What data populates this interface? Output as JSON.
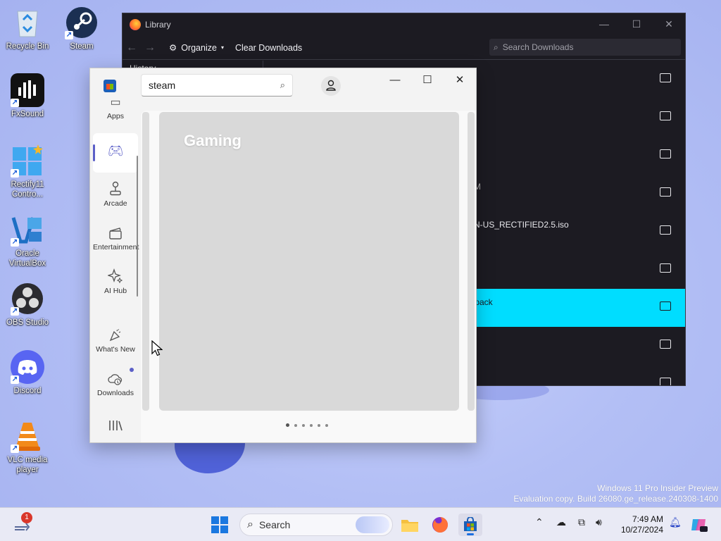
{
  "desktop": {
    "icons": [
      {
        "label": "Recycle Bin"
      },
      {
        "label": "Steam"
      },
      {
        "label": "FxSound"
      },
      {
        "label": "Rectify11 Contro..."
      },
      {
        "label": "Oracle VirtualBox"
      },
      {
        "label": "OBS Studio"
      },
      {
        "label": "Discord"
      },
      {
        "label": "VLC media player"
      }
    ],
    "watermark": {
      "line1": "Windows 11 Pro Insider Preview",
      "line2": "Evaluation copy. Build 26080.ge_release.240308-1400"
    }
  },
  "library": {
    "title": "Library",
    "toolbar": {
      "back": "←",
      "forward": "→",
      "organize": "Organize",
      "clear_downloads": "Clear Downloads"
    },
    "search_placeholder": "Search Downloads",
    "sidebar_history": "History",
    "rows": [
      {
        "name": "",
        "meta": ""
      },
      {
        "name": "",
        "meta": ""
      },
      {
        "name": "",
        "meta": ""
      },
      {
        "name": "",
        "meta": "AM"
      },
      {
        "name": "EN-US_RECTIFIED2.5.iso",
        "meta": ""
      },
      {
        "name": "",
        "meta": ""
      },
      {
        "name": "xtpack",
        "meta": ""
      },
      {
        "name": "",
        "meta": ""
      },
      {
        "name": "",
        "meta": ""
      }
    ]
  },
  "store": {
    "search_value": "steam",
    "rail": {
      "apps": "Apps",
      "gaming": "",
      "arcade": "Arcade",
      "entertainment": "Entertainment",
      "ai_hub": "AI Hub",
      "whats_new": "What's New",
      "downloads": "Downloads"
    },
    "hero_title": "Gaming"
  },
  "taskbar": {
    "search_label": "Search",
    "notification_count": "1",
    "time": "7:49 AM",
    "date": "10/27/2024"
  },
  "colors": {
    "library_selected_row": "#00ddff",
    "accent": "#5b5fc7",
    "library_bg": "#1c1b22"
  }
}
